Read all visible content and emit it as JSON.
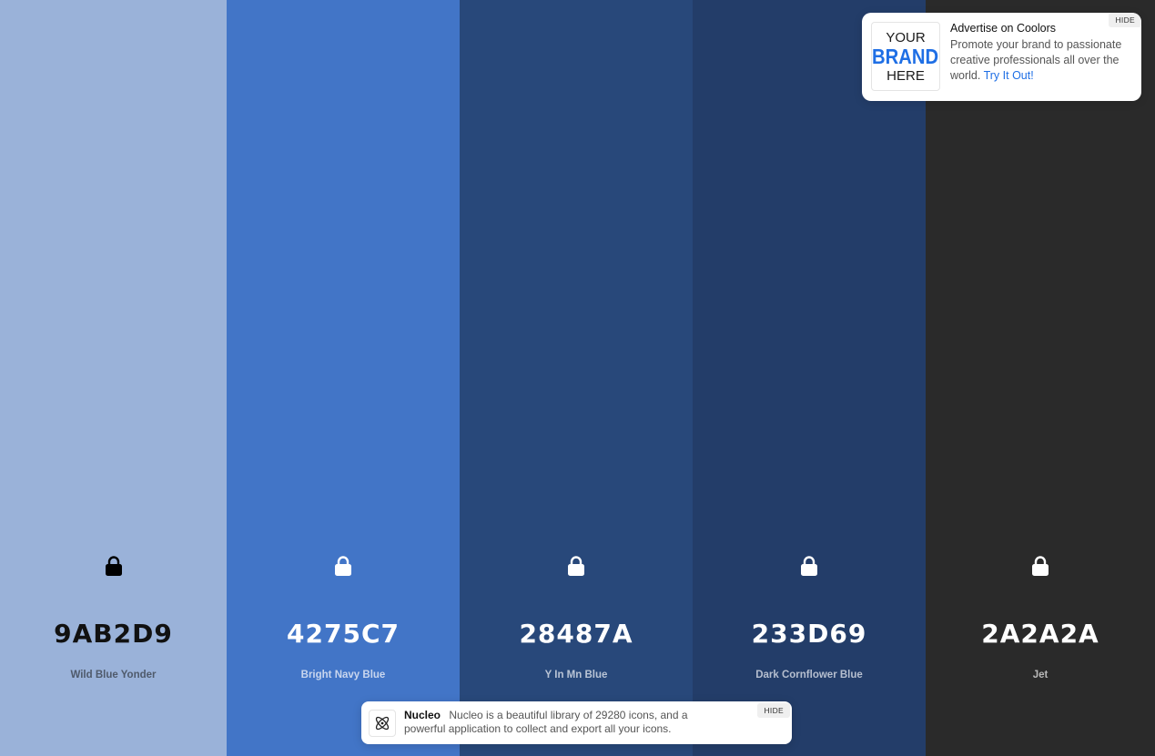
{
  "palette": [
    {
      "hex": "9AB2D9",
      "name": "Wild Blue Yonder",
      "bg": "#9AB2D9",
      "text_color": "#111111",
      "name_color": "#4f5a6b",
      "lock_color": "#000000"
    },
    {
      "hex": "4275C7",
      "name": "Bright Navy Blue",
      "bg": "#4275C7",
      "text_color": "#ffffff",
      "name_color": "#c9d6ee",
      "lock_color": "#ffffff"
    },
    {
      "hex": "28487A",
      "name": "Y In Mn Blue",
      "bg": "#28487A",
      "text_color": "#ffffff",
      "name_color": "#b9c4d5",
      "lock_color": "#ffffff"
    },
    {
      "hex": "233D69",
      "name": "Dark Cornflower Blue",
      "bg": "#233D69",
      "text_color": "#ffffff",
      "name_color": "#b6bfcf",
      "lock_color": "#ffffff"
    },
    {
      "hex": "2A2A2A",
      "name": "Jet",
      "bg": "#2A2A2A",
      "text_color": "#ffffff",
      "name_color": "#b8b8b8",
      "lock_color": "#ffffff"
    }
  ],
  "icons": {
    "lock": "lock-icon",
    "atom": "atom-icon"
  },
  "ad": {
    "logo_line1": "YOUR",
    "logo_line2": "BRAND",
    "logo_line3": "HERE",
    "title": "Advertise on Coolors",
    "body": "Promote your brand to passionate creative professionals all over the world.",
    "cta": "Try It Out!",
    "hide_label": "HIDE"
  },
  "notice": {
    "title": "Nucleo",
    "body": "Nucleo is a beautiful library of 29280 icons, and a powerful application to collect and export all your icons.",
    "hide_label": "HIDE"
  },
  "colors": {
    "brand_blue": "#1f6fe5"
  }
}
